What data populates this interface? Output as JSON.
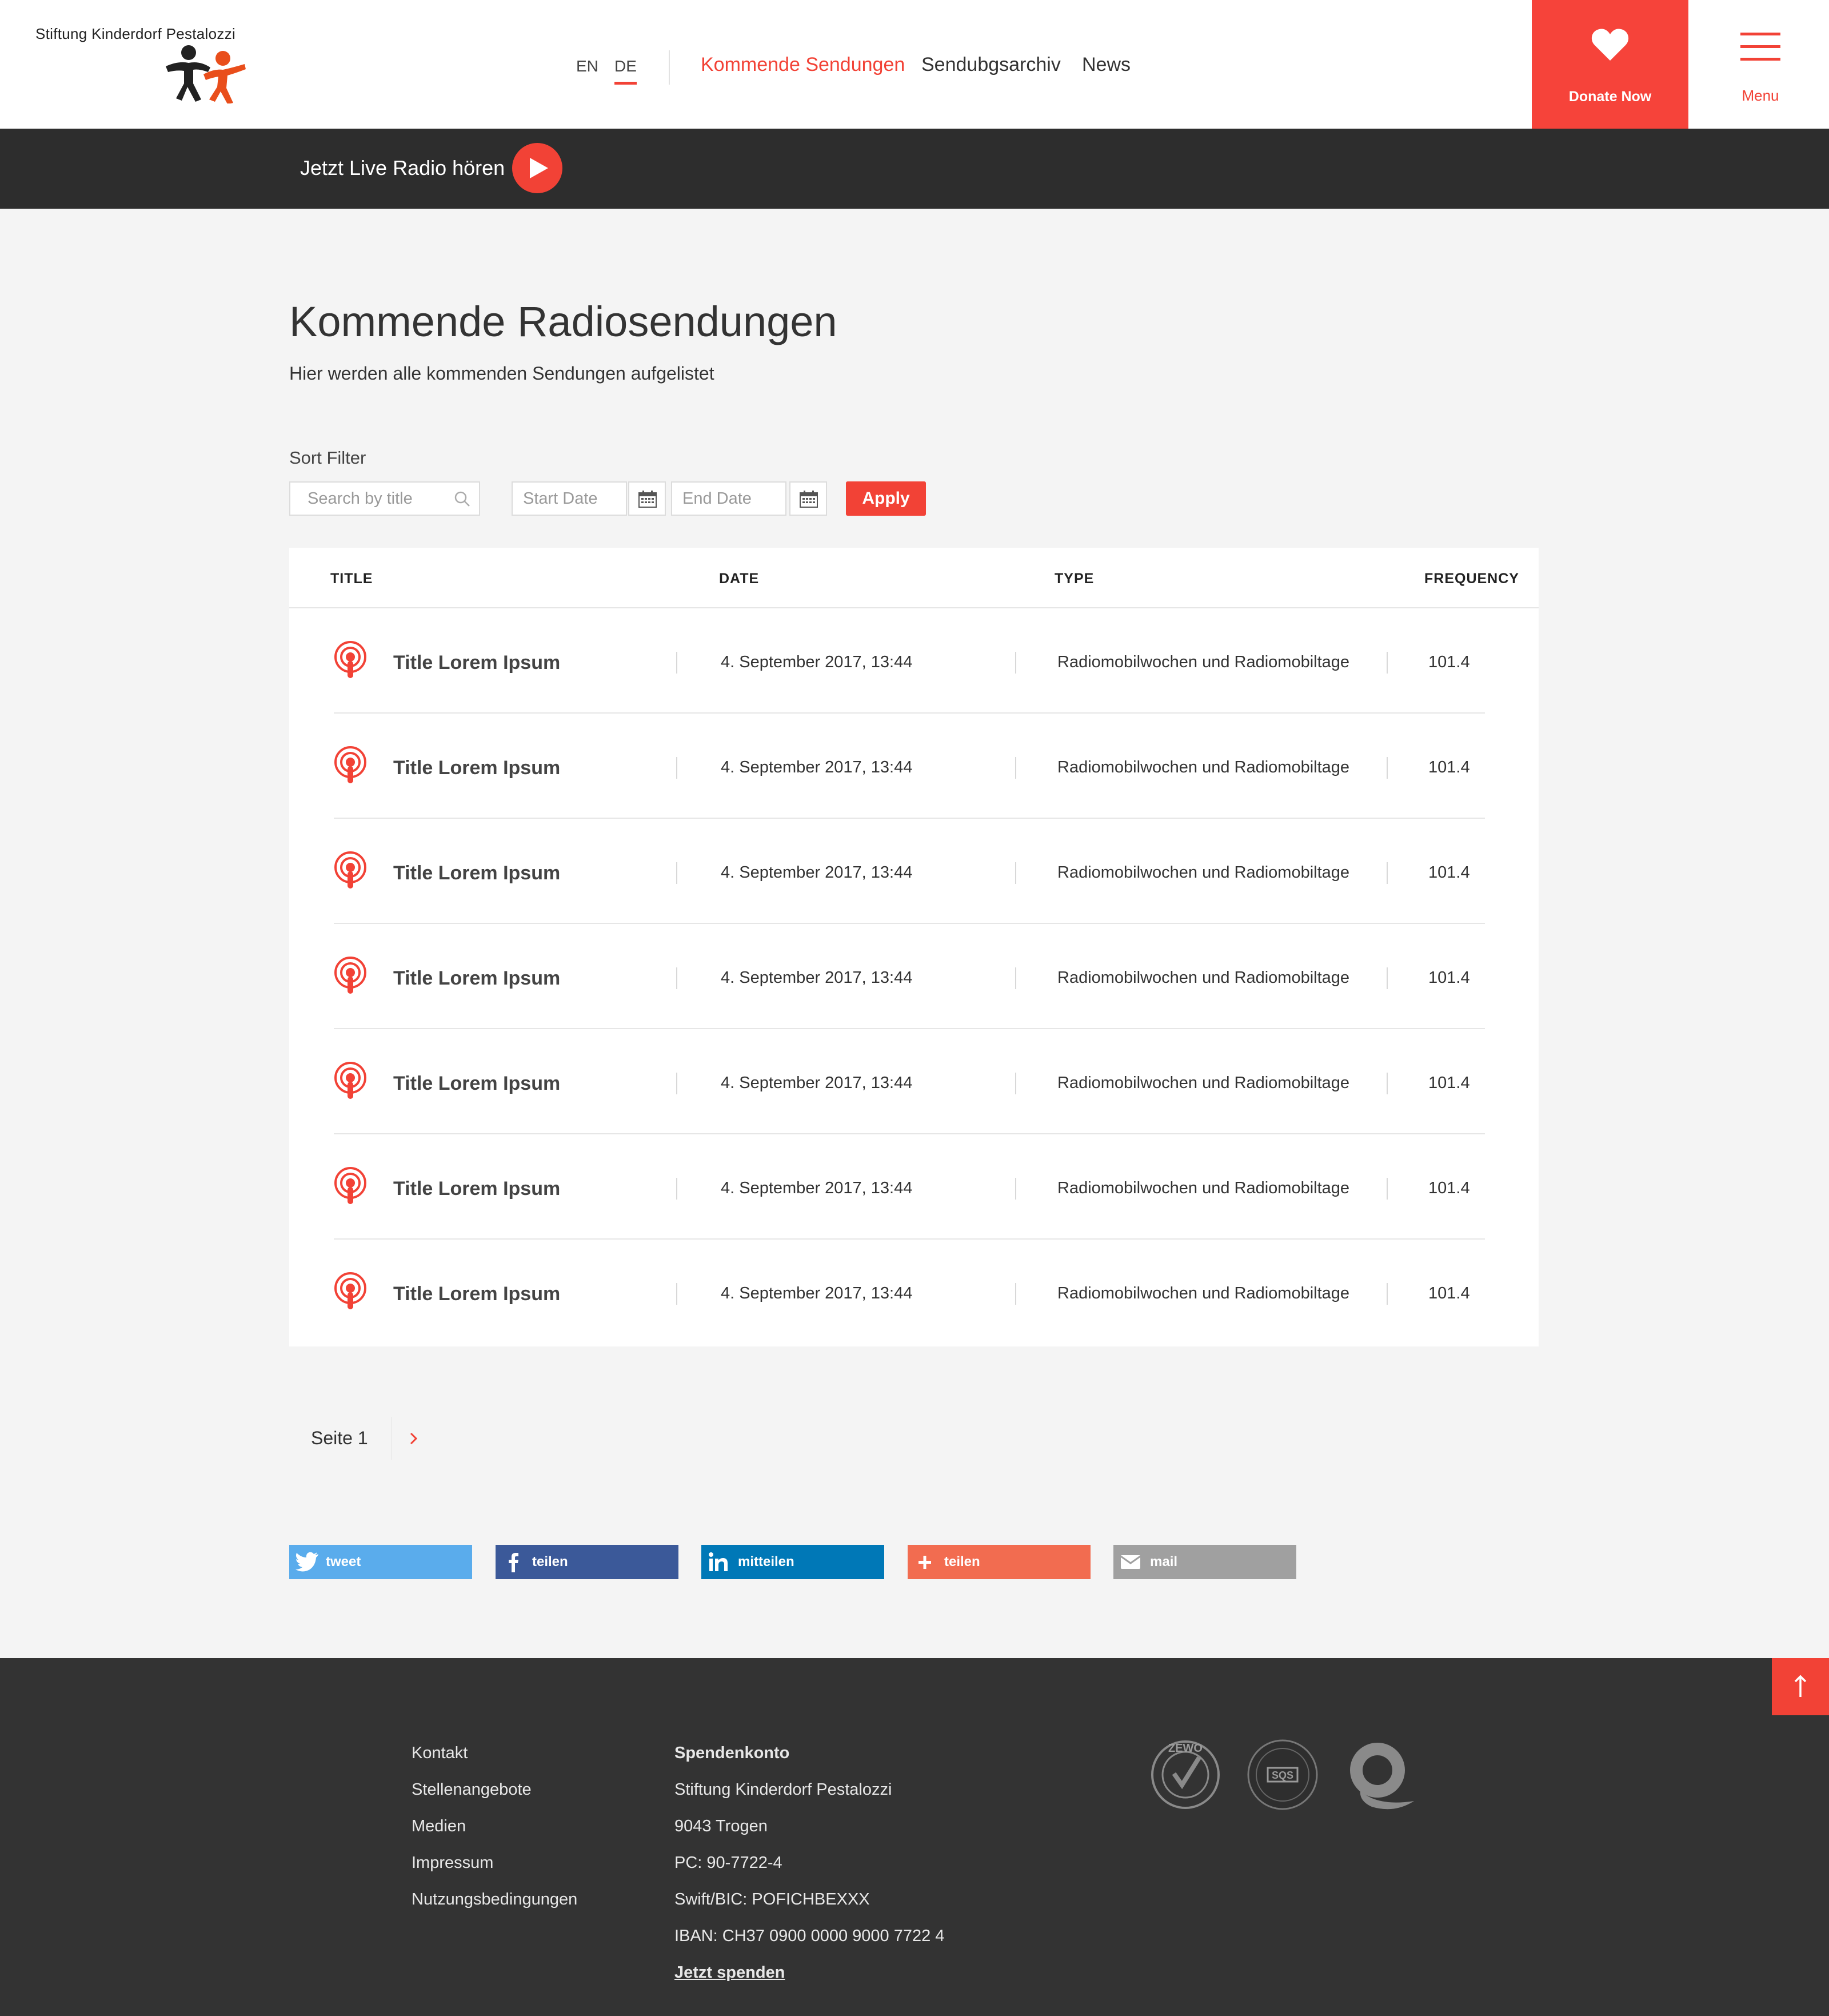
{
  "header": {
    "logo_text": "Stiftung Kinderdorf Pestalozzi",
    "languages": [
      {
        "code": "EN",
        "active": false
      },
      {
        "code": "DE",
        "active": true
      }
    ],
    "nav": [
      {
        "label": "Kommende Sendungen",
        "active": true
      },
      {
        "label": "Sendubgsarchiv",
        "active": false
      },
      {
        "label": "News",
        "active": false
      }
    ],
    "donate_label": "Donate Now",
    "menu_label": "Menu"
  },
  "livebar": {
    "label": "Jetzt Live Radio hören"
  },
  "page": {
    "title": "Kommende Radiosendungen",
    "subtitle": "Hier werden alle kommenden Sendungen aufgelistet"
  },
  "filter": {
    "label": "Sort Filter",
    "search_placeholder": "Search by title",
    "start_placeholder": "Start Date",
    "end_placeholder": "End Date",
    "apply_label": "Apply"
  },
  "table": {
    "columns": [
      "TITLE",
      "DATE",
      "TYPE",
      "FREQUENCY"
    ],
    "rows": [
      {
        "title": "Title Lorem Ipsum",
        "date": "4. September 2017, 13:44",
        "type": "Radiomobilwochen und Radiomobiltage",
        "frequency": "101.4"
      },
      {
        "title": "Title Lorem Ipsum",
        "date": "4. September 2017, 13:44",
        "type": "Radiomobilwochen und Radiomobiltage",
        "frequency": "101.4"
      },
      {
        "title": "Title Lorem Ipsum",
        "date": "4. September 2017, 13:44",
        "type": "Radiomobilwochen und Radiomobiltage",
        "frequency": "101.4"
      },
      {
        "title": "Title Lorem Ipsum",
        "date": "4. September 2017, 13:44",
        "type": "Radiomobilwochen und Radiomobiltage",
        "frequency": "101.4"
      },
      {
        "title": "Title Lorem Ipsum",
        "date": "4. September 2017, 13:44",
        "type": "Radiomobilwochen und Radiomobiltage",
        "frequency": "101.4"
      },
      {
        "title": "Title Lorem Ipsum",
        "date": "4. September 2017, 13:44",
        "type": "Radiomobilwochen und Radiomobiltage",
        "frequency": "101.4"
      },
      {
        "title": "Title Lorem Ipsum",
        "date": "4. September 2017, 13:44",
        "type": "Radiomobilwochen und Radiomobiltage",
        "frequency": "101.4"
      }
    ]
  },
  "pagination": {
    "label": "Seite 1"
  },
  "share": [
    {
      "label": "tweet",
      "icon": "twitter-icon",
      "color": "#5aacec"
    },
    {
      "label": "teilen",
      "icon": "facebook-icon",
      "color": "#3b5999"
    },
    {
      "label": "mitteilen",
      "icon": "linkedin-icon",
      "color": "#0078b7"
    },
    {
      "label": "teilen",
      "icon": "plus-icon",
      "color": "#f26c50"
    },
    {
      "label": "mail",
      "icon": "mail-icon",
      "color": "#a0a0a0"
    }
  ],
  "footer": {
    "links": [
      "Kontakt",
      "Stellenangebote",
      "Medien",
      "Impressum",
      "Nutzungsbedingungen"
    ],
    "bank": {
      "heading": "Spendenkonto",
      "lines": [
        "Stiftung Kinderdorf Pestalozzi",
        "9043 Trogen",
        "PC: 90-7722-4",
        "Swift/BIC: POFICHBEXXX",
        "IBAN: CH37 0900 0000 9000 7722 4"
      ],
      "link": "Jetzt spenden"
    },
    "certificates": [
      {
        "name": "zewo-seal",
        "text": "ZEWO"
      },
      {
        "name": "sqs-seal",
        "text": "SQS"
      },
      {
        "name": "q-seal",
        "text": ""
      }
    ]
  },
  "colors": {
    "accent": "#f24236",
    "dark_bar": "#2d2d2d",
    "footer": "#333333",
    "page_bg": "#f4f4f4"
  }
}
